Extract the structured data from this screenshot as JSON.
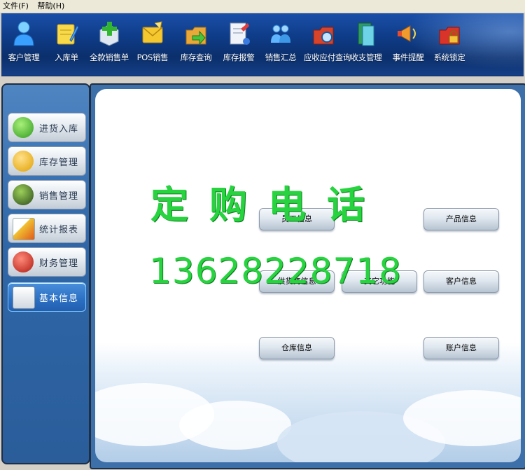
{
  "menu": [
    "文件(F)",
    "帮助(H)"
  ],
  "toolbar": [
    {
      "label": "客户管理",
      "icon": "person-icon"
    },
    {
      "label": "入库单",
      "icon": "notepad-pencil-icon"
    },
    {
      "label": "全款销售单",
      "icon": "add-box-icon"
    },
    {
      "label": "POS销售",
      "icon": "envelope-icon"
    },
    {
      "label": "库存查询",
      "icon": "folder-arrow-icon"
    },
    {
      "label": "库存报警",
      "icon": "document-alert-icon"
    },
    {
      "label": "销售汇总",
      "icon": "people-group-icon"
    },
    {
      "label": "应收应付查询",
      "icon": "folder-search-icon"
    },
    {
      "label": "收支管理",
      "icon": "ledger-icon"
    },
    {
      "label": "事件提醒",
      "icon": "megaphone-icon"
    },
    {
      "label": "系统锁定",
      "icon": "lock-folder-icon"
    }
  ],
  "sidebar": [
    {
      "label": "进货入库",
      "icon": "cubes-icon"
    },
    {
      "label": "库存管理",
      "icon": "user-icon"
    },
    {
      "label": "销售管理",
      "icon": "globe-icon"
    },
    {
      "label": "统计报表",
      "icon": "chart-icon"
    },
    {
      "label": "财务管理",
      "icon": "finance-icon"
    },
    {
      "label": "基本信息",
      "icon": "document-icon"
    }
  ],
  "panel_buttons": [
    {
      "label": "员工信息"
    },
    {
      "label": "产品信息"
    },
    {
      "label": "供货商信息"
    },
    {
      "label": "其它功能"
    },
    {
      "label": "客户信息"
    },
    {
      "label": "仓库信息"
    },
    {
      "label": "账户信息"
    }
  ],
  "watermark": {
    "line1": "定购电话",
    "line2": "13628228718"
  },
  "colors": {
    "toolbar": "#0f3d8a",
    "sidebar": "#2f67a8",
    "watermark": "#27d43f"
  }
}
